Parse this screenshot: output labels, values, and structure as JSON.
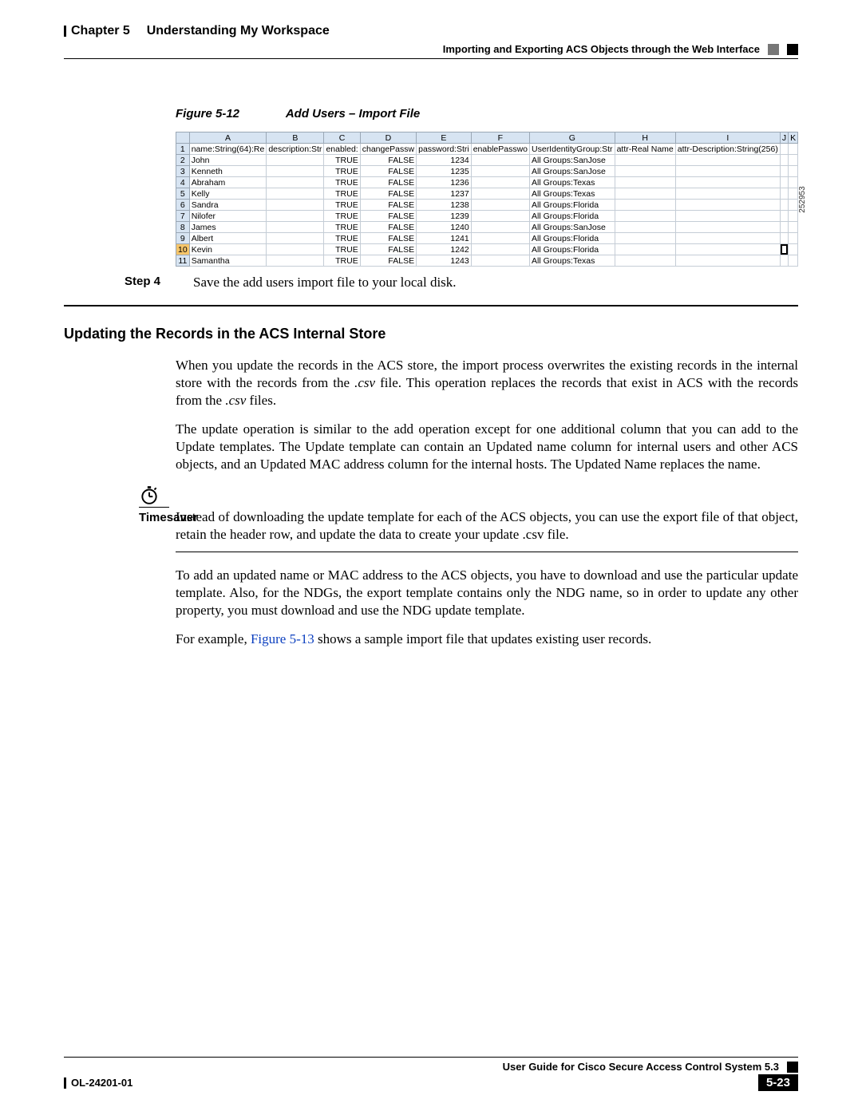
{
  "header": {
    "chapter": "Chapter 5",
    "title": "Understanding My Workspace",
    "section": "Importing and Exporting ACS Objects through the Web Interface"
  },
  "figure": {
    "label": "Figure 5-12",
    "title": "Add Users – Import File",
    "image_id": "252953",
    "columns": [
      "A",
      "B",
      "C",
      "D",
      "E",
      "F",
      "G",
      "H",
      "I",
      "J",
      "K"
    ],
    "header_row": [
      "name:String(64):Re",
      "description:Str",
      "enabled:",
      "changePassw",
      "password:Stri",
      "enablePasswo",
      "UserIdentityGroup:Str",
      "attr-Real Name",
      "attr-Description:String(256)",
      "",
      ""
    ],
    "rows": [
      {
        "n": "2",
        "a": "John",
        "c": "TRUE",
        "d": "FALSE",
        "e": "1234",
        "g": "All Groups:SanJose"
      },
      {
        "n": "3",
        "a": "Kenneth",
        "c": "TRUE",
        "d": "FALSE",
        "e": "1235",
        "g": "All Groups:SanJose"
      },
      {
        "n": "4",
        "a": "Abraham",
        "c": "TRUE",
        "d": "FALSE",
        "e": "1236",
        "g": "All Groups:Texas"
      },
      {
        "n": "5",
        "a": "Kelly",
        "c": "TRUE",
        "d": "FALSE",
        "e": "1237",
        "g": "All Groups:Texas"
      },
      {
        "n": "6",
        "a": "Sandra",
        "c": "TRUE",
        "d": "FALSE",
        "e": "1238",
        "g": "All Groups:Florida"
      },
      {
        "n": "7",
        "a": "Nilofer",
        "c": "TRUE",
        "d": "FALSE",
        "e": "1239",
        "g": "All Groups:Florida"
      },
      {
        "n": "8",
        "a": "James",
        "c": "TRUE",
        "d": "FALSE",
        "e": "1240",
        "g": "All Groups:SanJose"
      },
      {
        "n": "9",
        "a": "Albert",
        "c": "TRUE",
        "d": "FALSE",
        "e": "1241",
        "g": "All Groups:Florida"
      },
      {
        "n": "10",
        "a": "Kevin",
        "c": "TRUE",
        "d": "FALSE",
        "e": "1242",
        "g": "All Groups:Florida",
        "sel": true
      },
      {
        "n": "11",
        "a": "Samantha",
        "c": "TRUE",
        "d": "FALSE",
        "e": "1243",
        "g": "All Groups:Texas"
      }
    ]
  },
  "step": {
    "label": "Step 4",
    "text": "Save the add users import file to your local disk."
  },
  "section_heading": "Updating the Records in the ACS Internal Store",
  "body": {
    "p1a": "When you update the records in the ACS store, the import process overwrites the existing records in the internal store with the records from the ",
    "p1b": ".csv",
    "p1c": " file. This operation replaces the records that exist in ACS with the records from the ",
    "p1d": ".csv",
    "p1e": " files.",
    "p2": "The update operation is similar to the add operation except for one additional column that you can add to the Update templates. The Update template can contain an Updated name column for internal users and other ACS objects, and an Updated MAC address column for the internal hosts. The Updated Name replaces the name."
  },
  "timesaver": {
    "label": "Timesaver",
    "text": "Instead of downloading the update template for each of the ACS objects, you can use the export file of that object, retain the header row, and update the data to create your update .csv file."
  },
  "after": {
    "p1": "To add an updated name or MAC address to the ACS objects, you have to download and use the particular update template. Also, for the NDGs, the export template contains only the NDG name, so in order to update any other property, you must download and use the NDG update template.",
    "p2a": "For example, ",
    "p2link": "Figure 5-13",
    "p2b": " shows a sample import file that updates existing user records."
  },
  "footer": {
    "guide": "User Guide for Cisco Secure Access Control System 5.3",
    "doc": "OL-24201-01",
    "page": "5-23"
  }
}
